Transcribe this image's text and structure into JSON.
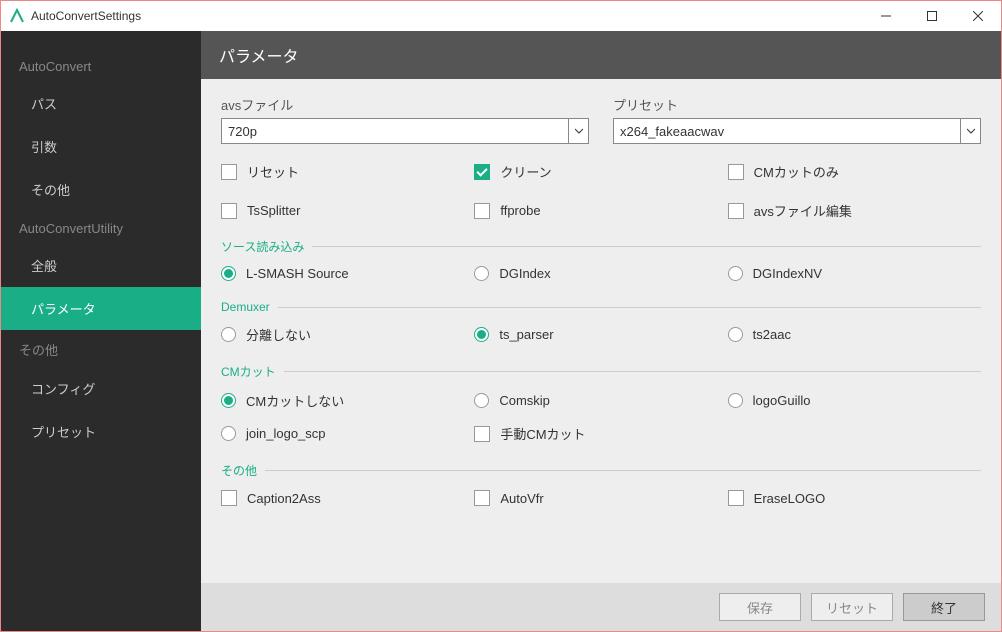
{
  "titlebar": {
    "title": "AutoConvertSettings"
  },
  "sidebar": {
    "groups": [
      {
        "label": "AutoConvert",
        "items": [
          "パス",
          "引数",
          "その他"
        ]
      },
      {
        "label": "AutoConvertUtility",
        "items": [
          "全般",
          "パラメータ"
        ]
      },
      {
        "label": "その他",
        "items": [
          "コンフィグ",
          "プリセット"
        ]
      }
    ],
    "selected": "パラメータ"
  },
  "header": {
    "title": "パラメータ"
  },
  "fields": {
    "avs": {
      "label": "avsファイル",
      "value": "720p"
    },
    "preset": {
      "label": "プリセット",
      "value": "x264_fakeaacwav"
    }
  },
  "checks1": [
    {
      "label": "リセット",
      "checked": false
    },
    {
      "label": "クリーン",
      "checked": true
    },
    {
      "label": "CMカットのみ",
      "checked": false
    }
  ],
  "checks2": [
    {
      "label": "TsSplitter",
      "checked": false
    },
    {
      "label": "ffprobe",
      "checked": false
    },
    {
      "label": "avsファイル編集",
      "checked": false
    }
  ],
  "sections": {
    "source": {
      "title": "ソース読み込み",
      "options": [
        "L-SMASH Source",
        "DGIndex",
        "DGIndexNV"
      ],
      "selected": 0
    },
    "demuxer": {
      "title": "Demuxer",
      "options": [
        "分離しない",
        "ts_parser",
        "ts2aac"
      ],
      "selected": 1
    },
    "cmcut": {
      "title": "CMカット",
      "options": [
        "CMカットしない",
        "Comskip",
        "logoGuillo",
        "join_logo_scp"
      ],
      "extra": "手動CMカット",
      "selected": 0
    },
    "other": {
      "title": "その他",
      "options": [
        "Caption2Ass",
        "AutoVfr",
        "EraseLOGO"
      ]
    }
  },
  "footer": {
    "save": "保存",
    "reset": "リセット",
    "exit": "終了"
  }
}
